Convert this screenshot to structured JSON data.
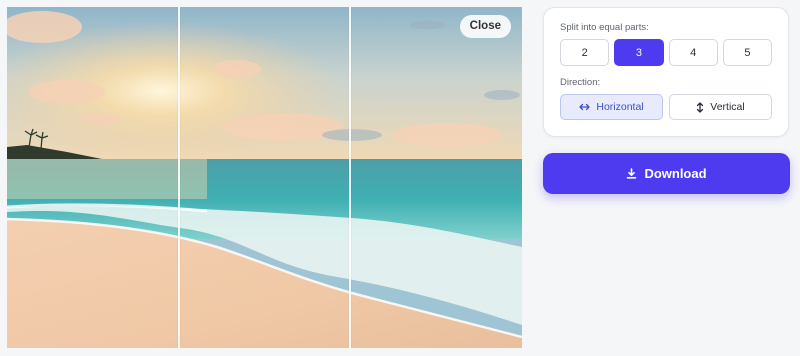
{
  "preview": {
    "close_label": "Close",
    "split_count": 3,
    "direction": "horizontal"
  },
  "settings": {
    "split_label": "Split into equal parts:",
    "parts": [
      {
        "label": "2",
        "active": false
      },
      {
        "label": "3",
        "active": true
      },
      {
        "label": "4",
        "active": false
      },
      {
        "label": "5",
        "active": false
      }
    ],
    "direction_label": "Direction:",
    "directions": [
      {
        "label": "Horizontal",
        "icon": "arrows-horizontal-icon",
        "active": true
      },
      {
        "label": "Vertical",
        "icon": "arrows-vertical-icon",
        "active": false
      }
    ]
  },
  "download": {
    "label": "Download",
    "icon": "download-icon"
  },
  "colors": {
    "accent": "#4f3bef",
    "active_direction_bg": "#e7ebfb",
    "page_bg": "#f5f6f8"
  }
}
